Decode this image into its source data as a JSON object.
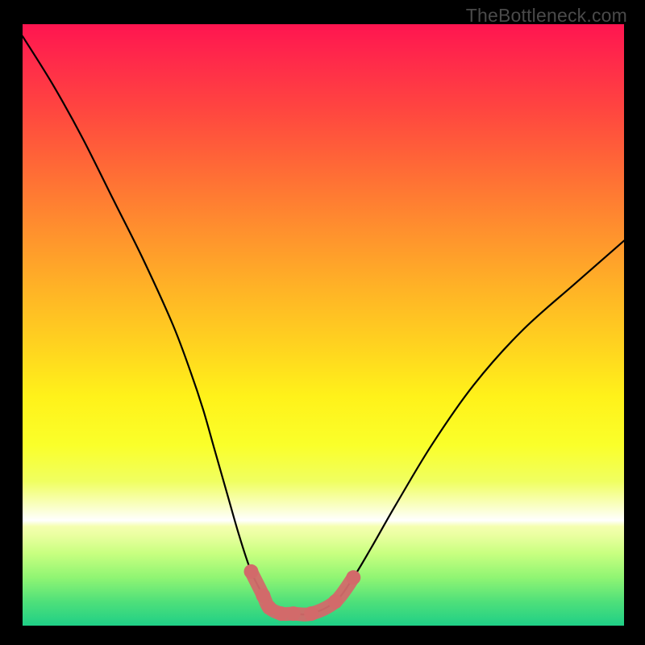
{
  "watermark": "TheBottleneck.com",
  "chart_data": {
    "type": "line",
    "title": "",
    "xlabel": "",
    "ylabel": "",
    "xlim": [
      0,
      100
    ],
    "ylim": [
      0,
      100
    ],
    "series": [
      {
        "name": "bottleneck-curve",
        "x": [
          0,
          5,
          10,
          15,
          20,
          25,
          28,
          30,
          32,
          34,
          36,
          38,
          40,
          41,
          43,
          45,
          48,
          52,
          55,
          58,
          62,
          68,
          75,
          83,
          92,
          100
        ],
        "values": [
          98,
          90,
          81,
          71,
          61,
          50,
          42,
          36,
          29,
          22,
          15,
          9,
          5,
          3,
          2,
          2,
          2,
          4,
          8,
          13,
          20,
          30,
          40,
          49,
          57,
          64
        ]
      }
    ],
    "markers": {
      "name": "minimum-region-markers",
      "x": [
        38,
        40,
        41,
        43,
        45,
        48,
        52,
        55
      ],
      "values": [
        9,
        5,
        3,
        2,
        2,
        2,
        4,
        8
      ]
    },
    "colors": {
      "curve": "#000000",
      "markers": "#d26a6a"
    }
  }
}
